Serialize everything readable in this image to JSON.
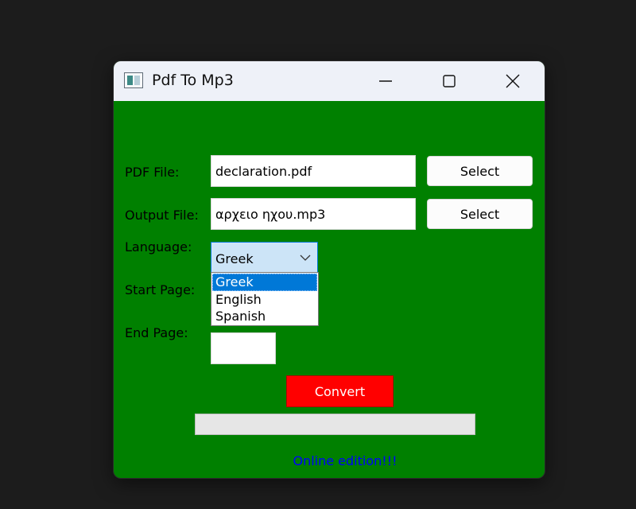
{
  "window": {
    "title": "Pdf To Mp3"
  },
  "form": {
    "pdf_file": {
      "label": "PDF File:",
      "value": "declaration.pdf",
      "button": "Select"
    },
    "output_file": {
      "label": "Output File:",
      "value": "αρχειο ηχου.mp3",
      "button": "Select"
    },
    "language": {
      "label": "Language:",
      "selected": "Greek",
      "options": [
        "Greek",
        "English",
        "Spanish"
      ]
    },
    "start_page": {
      "label": "Start Page:",
      "value": ""
    },
    "end_page": {
      "label": "End Page:",
      "value": ""
    },
    "convert_label": "Convert",
    "progress_fraction": 0
  },
  "footer": {
    "text": "Online edition!!!"
  },
  "colors": {
    "window_bg": "#008000",
    "convert_bg": "#ff0000",
    "footer_text": "#0000ff",
    "selected_option": "#0078d7"
  },
  "icons": [
    "app-window-icon",
    "minimize-icon",
    "maximize-icon",
    "close-icon",
    "chevron-down-icon"
  ]
}
